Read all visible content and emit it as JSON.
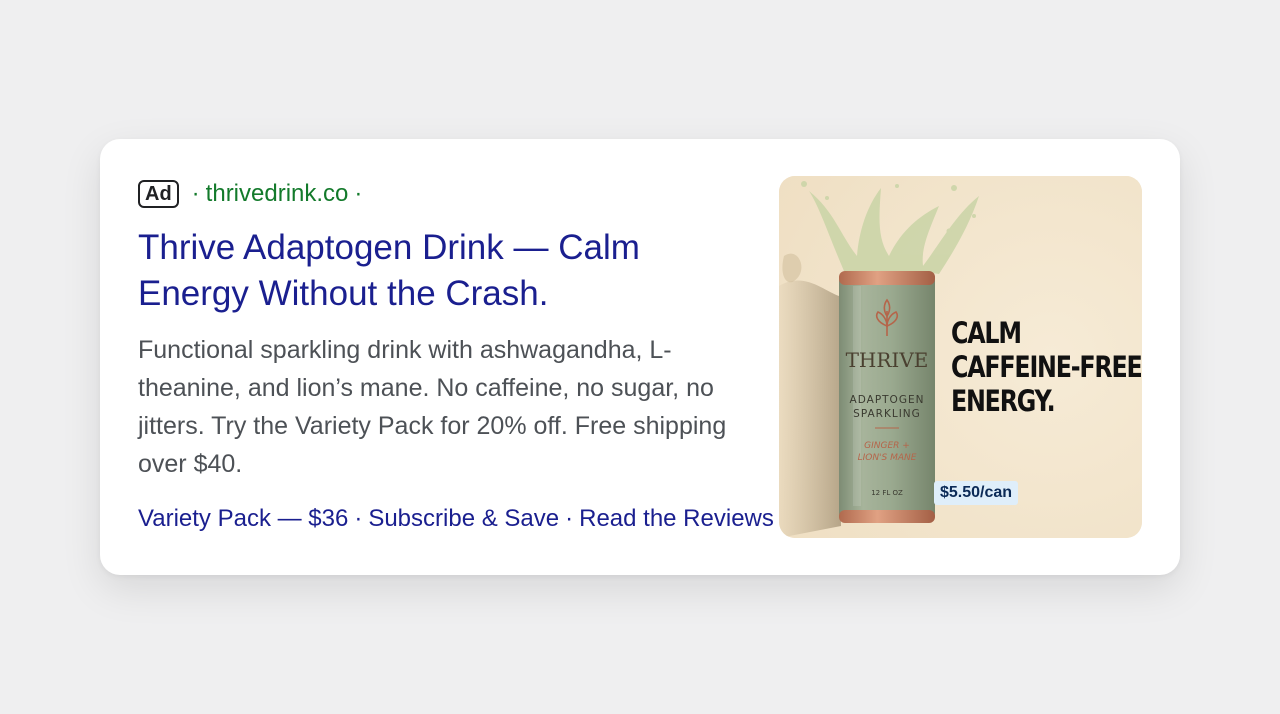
{
  "ad": {
    "badge": "Ad",
    "domain": "thrivedrink.co",
    "headline": "Thrive Adaptogen Drink — Calm Energy Without the Crash.",
    "description": "Functional sparkling drink with ashwagandha, L-theanine, and lion’s mane. No caffeine, no sugar, no jitters. Try the Variety Pack for 20% off. Free shipping over $40.",
    "sitelinks": [
      "Variety Pack — $36",
      "Subscribe & Save",
      "Read the Reviews"
    ]
  },
  "creative": {
    "can": {
      "brand": "THRIVE",
      "line1": "ADAPTOGEN",
      "line2": "SPARKLING",
      "flavor1": "GINGER +",
      "flavor2": "LION'S MANE",
      "volume": "12 FL OZ"
    },
    "tagline": [
      "CALM",
      "CAFFEINE-FREE",
      "ENERGY."
    ],
    "price": "$5.50/can"
  },
  "colors": {
    "headline": "#1a1f8f",
    "domain": "#137a2b",
    "creative_bg": "#f3e6cf",
    "can": "#9aa98f"
  }
}
